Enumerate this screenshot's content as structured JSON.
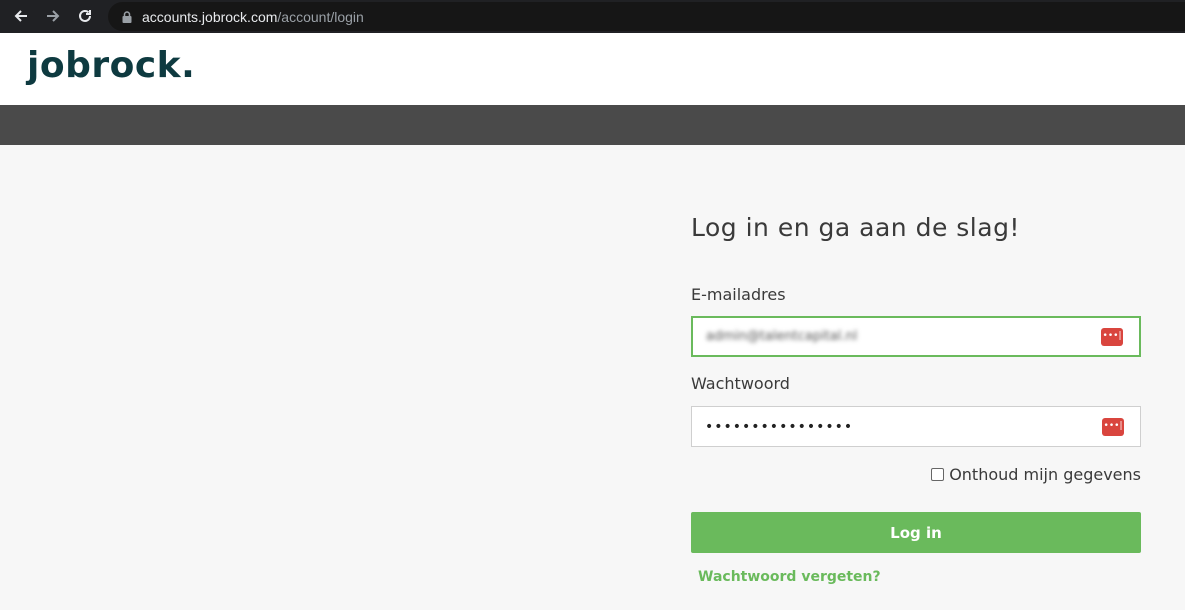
{
  "browser": {
    "url_host": "accounts.jobrock.com",
    "url_path": "/account/login",
    "back_icon": "arrow-left-icon",
    "forward_icon": "arrow-right-icon",
    "reload_icon": "reload-icon",
    "lock_icon": "lock-icon"
  },
  "header": {
    "logo_text": "jobrock",
    "logo_dot": "."
  },
  "login": {
    "title": "Log in en ga aan de slag!",
    "email_label": "E-mailadres",
    "email_value": "admin@talentcapital.nl",
    "password_label": "Wachtwoord",
    "password_value": "••••••••••••••••",
    "password_manager_icon": "password-manager-icon",
    "password_manager_glyph": "•••|",
    "remember_label": "Onthoud mijn gegevens",
    "remember_checked": false,
    "submit_label": "Log in",
    "forgot_label": "Wachtwoord vergeten?"
  },
  "colors": {
    "accent_green": "#6aba5c",
    "logo_color": "#0e3a40",
    "band_gray": "#4a4a4a",
    "password_manager_red": "#d9453e"
  }
}
